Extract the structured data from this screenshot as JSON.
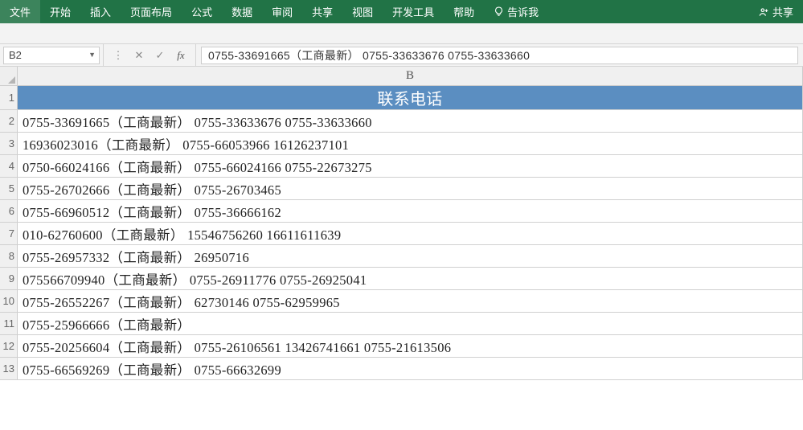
{
  "ribbon": {
    "tabs": [
      "文件",
      "开始",
      "插入",
      "页面布局",
      "公式",
      "数据",
      "审阅",
      "共享",
      "视图",
      "开发工具",
      "帮助"
    ],
    "tell_me": "告诉我",
    "share": "共享"
  },
  "fxbar": {
    "cell_ref": "B2",
    "formula": "0755-33691665（工商最新） 0755-33633676 0755-33633660"
  },
  "grid": {
    "column_label": "B",
    "header_cell": "联系电话",
    "row_numbers": [
      "1",
      "2",
      "3",
      "4",
      "5",
      "6",
      "7",
      "8",
      "9",
      "10",
      "11",
      "12",
      "13"
    ],
    "rows": [
      "0755-33691665（工商最新） 0755-33633676 0755-33633660",
      "16936023016（工商最新） 0755-66053966 16126237101",
      "0750-66024166（工商最新） 0755-66024166 0755-22673275",
      "0755-26702666（工商最新） 0755-26703465",
      "0755-66960512（工商最新） 0755-36666162",
      "010-62760600（工商最新） 15546756260 16611611639",
      "0755-26957332（工商最新） 26950716",
      "075566709940（工商最新） 0755-26911776 0755-26925041",
      "0755-26552267（工商最新） 62730146 0755-62959965",
      "0755-25966666（工商最新）",
      "0755-20256604（工商最新） 0755-26106561 13426741661 0755-21613506",
      "0755-66569269（工商最新） 0755-66632699"
    ]
  }
}
